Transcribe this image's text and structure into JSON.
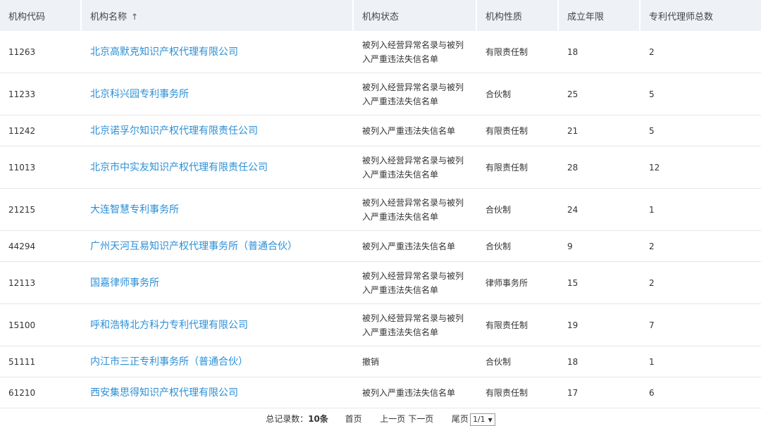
{
  "table": {
    "headers": {
      "code": "机构代码",
      "name": "机构名称",
      "status": "机构状态",
      "nature": "机构性质",
      "years": "成立年限",
      "agents": "专利代理师总数"
    },
    "sort_icon": "arrow-up-icon",
    "sort_glyph": "↑",
    "rows": [
      {
        "code": "11263",
        "name": "北京高默克知识产权代理有限公司",
        "status": "被列入经营异常名录与被列入严重违法失信名单",
        "nature": "有限责任制",
        "years": "18",
        "agents": "2"
      },
      {
        "code": "11233",
        "name": "北京科兴园专利事务所",
        "status": "被列入经营异常名录与被列入严重违法失信名单",
        "nature": "合伙制",
        "years": "25",
        "agents": "5"
      },
      {
        "code": "11242",
        "name": "北京诺孚尔知识产权代理有限责任公司",
        "status": "被列入严重违法失信名单",
        "nature": "有限责任制",
        "years": "21",
        "agents": "5"
      },
      {
        "code": "11013",
        "name": "北京市中实友知识产权代理有限责任公司",
        "status": "被列入经营异常名录与被列入严重违法失信名单",
        "nature": "有限责任制",
        "years": "28",
        "agents": "12"
      },
      {
        "code": "21215",
        "name": "大连智慧专利事务所",
        "status": "被列入经营异常名录与被列入严重违法失信名单",
        "nature": "合伙制",
        "years": "24",
        "agents": "1"
      },
      {
        "code": "44294",
        "name": "广州天河互易知识产权代理事务所（普通合伙）",
        "status": "被列入严重违法失信名单",
        "nature": "合伙制",
        "years": "9",
        "agents": "2"
      },
      {
        "code": "12113",
        "name": "国嘉律师事务所",
        "status": "被列入经营异常名录与被列入严重违法失信名单",
        "nature": "律师事务所",
        "years": "15",
        "agents": "2"
      },
      {
        "code": "15100",
        "name": "呼和浩特北方科力专利代理有限公司",
        "status": "被列入经营异常名录与被列入严重违法失信名单",
        "nature": "有限责任制",
        "years": "19",
        "agents": "7"
      },
      {
        "code": "51111",
        "name": "内江市三正专利事务所（普通合伙）",
        "status": "撤销",
        "nature": "合伙制",
        "years": "18",
        "agents": "1"
      },
      {
        "code": "61210",
        "name": "西安集思得知识产权代理有限公司",
        "status": "被列入严重违法失信名单",
        "nature": "有限责任制",
        "years": "17",
        "agents": "6"
      }
    ]
  },
  "pager": {
    "total_label": "总记录数：",
    "total_value": "10条",
    "first": "首页",
    "prev": "上一页",
    "next": "下一页",
    "last": "尾页",
    "page_select": "1/1",
    "caret": "▼"
  },
  "colors": {
    "header_bg": "#eef2f7",
    "link": "#2b8fd6",
    "row_border": "#e4e7ec"
  }
}
